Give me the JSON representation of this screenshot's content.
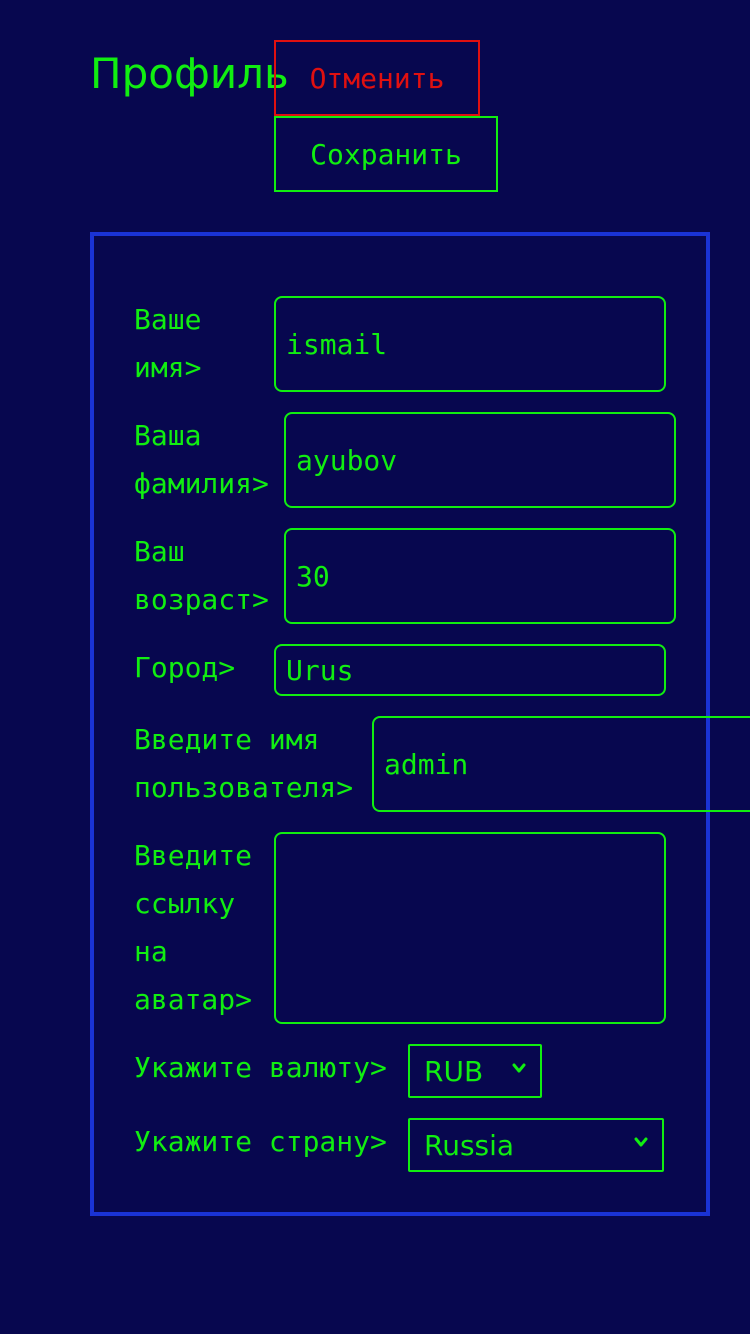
{
  "header": {
    "title": "Профиль",
    "cancel_label": "Отменить",
    "save_label": "Сохранить"
  },
  "form": {
    "first_name": {
      "label": "Ваше\nимя>",
      "value": "ismail"
    },
    "last_name": {
      "label": "Ваша\nфамилия>",
      "value": "ayubov"
    },
    "age": {
      "label": "Ваш\nвозраст>",
      "value": "30"
    },
    "city": {
      "label": "Город>",
      "value": "Urus"
    },
    "username": {
      "label": "Введите имя\nпользователя>",
      "value": "admin"
    },
    "avatar": {
      "label": "Введите\nссылку\nна\nаватар>",
      "value": ""
    },
    "currency": {
      "label": "Укажите валюту>",
      "value": "RUB"
    },
    "country": {
      "label": "Укажите страну>",
      "value": "Russia"
    }
  },
  "colors": {
    "background": "#07074f",
    "text": "#11ee11",
    "cancel": "#e01010",
    "panel_border": "#1a33d6"
  },
  "icons": {
    "select_arrow": "chevron-down-icon"
  }
}
